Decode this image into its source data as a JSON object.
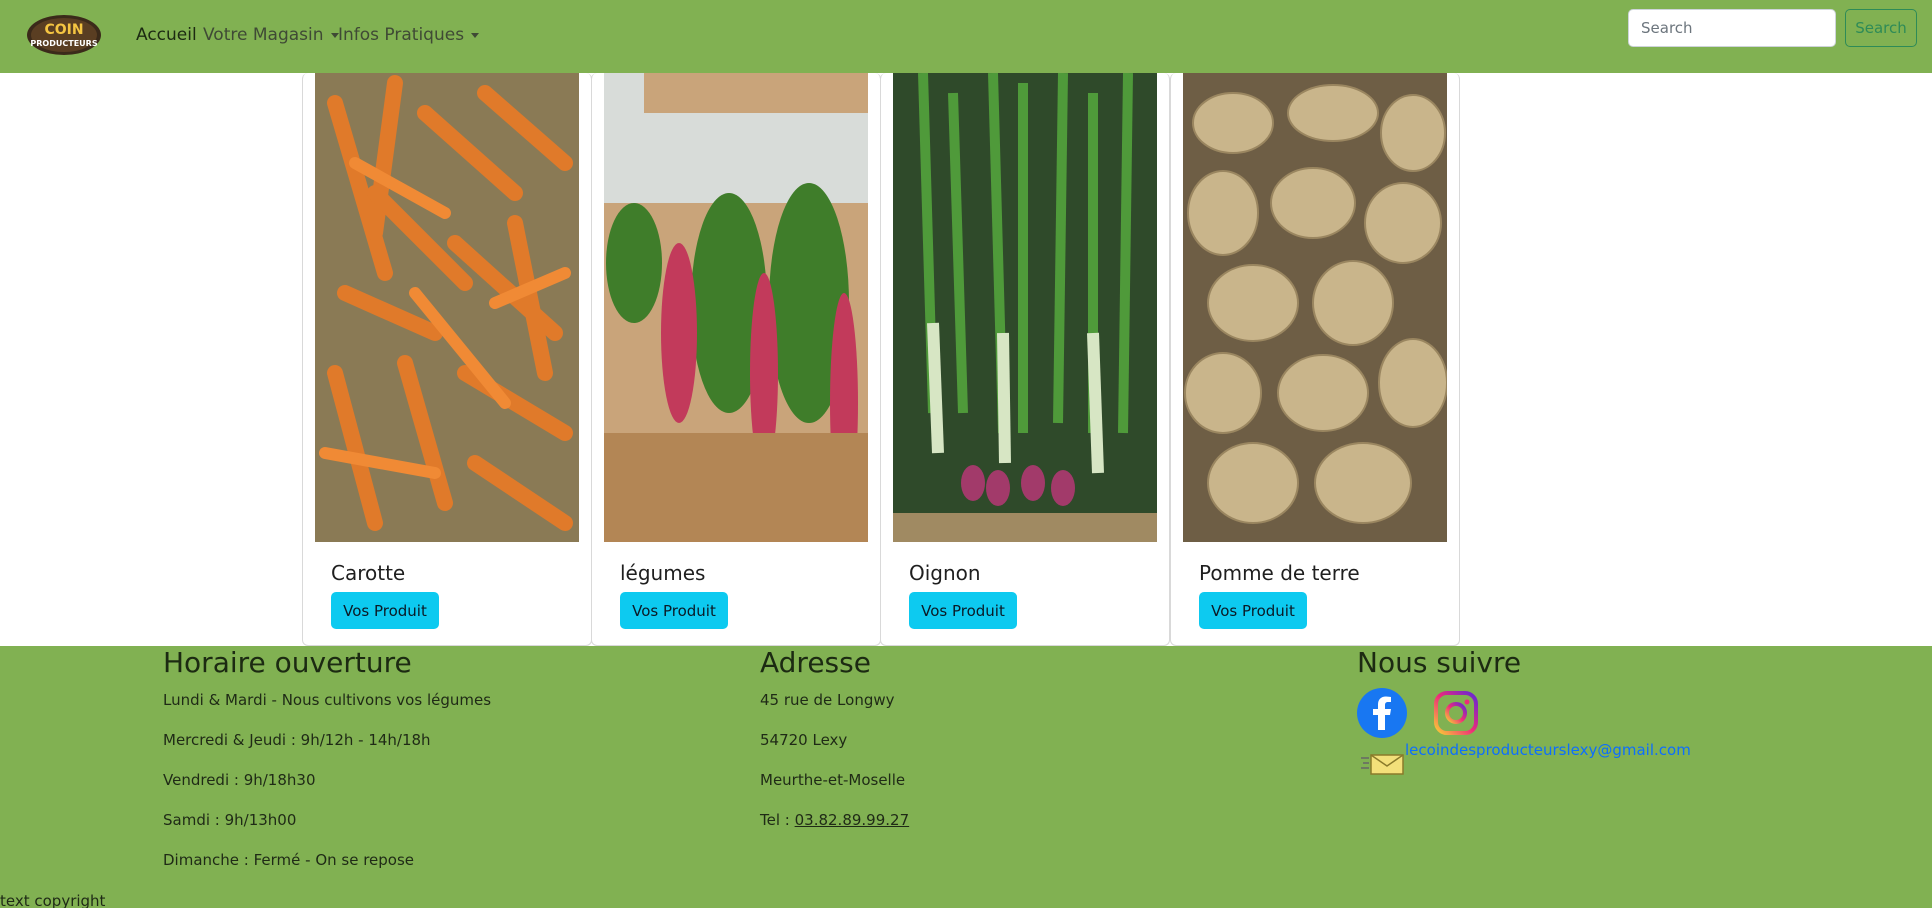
{
  "navbar": {
    "logo_alt": "Le Coin des Producteurs",
    "links": [
      {
        "label": "Accueil",
        "active": true
      },
      {
        "label": "Votre Magasin",
        "dropdown": true
      },
      {
        "label": "Infos Pratiques",
        "dropdown": true
      }
    ],
    "search_placeholder": "Search",
    "search_button": "Search"
  },
  "products": [
    {
      "name": "Carotte",
      "button": "Vos Produit",
      "image": "carrots-photo"
    },
    {
      "name": "légumes",
      "button": "Vos Produit",
      "image": "radish-lettuce-photo"
    },
    {
      "name": "Oignon",
      "button": "Vos Produit",
      "image": "spring-onions-photo"
    },
    {
      "name": "Pomme de terre",
      "button": "Vos Produit",
      "image": "potatoes-photo"
    }
  ],
  "footer": {
    "hours": {
      "title": "Horaire ouverture",
      "lines": [
        "Lundi & Mardi - Nous cultivons vos légumes",
        "Mercredi & Jeudi : 9h/12h - 14h/18h",
        "Vendredi : 9h/18h30",
        "Samdi : 9h/13h00",
        "Dimanche : Fermé - On se repose"
      ]
    },
    "address": {
      "title": "Adresse",
      "street": "45 rue de Longwy",
      "city": "54720 Lexy",
      "region": "Meurthe-et-Moselle",
      "tel_prefix": "Tel : ",
      "tel": "03.82.89.99.27"
    },
    "social": {
      "title": "Nous suivre",
      "email": "lecoindesproducteurslexy@gmail.com",
      "icons": [
        "facebook-icon",
        "instagram-icon",
        "mail-icon"
      ]
    },
    "copyright": "text copyright"
  },
  "colors": {
    "navbar_bg": "#81b152",
    "footer_bg": "#81b152",
    "button_info": "#0dcaf0",
    "search_outline": "#2e8b57",
    "email_link": "#0d6efd"
  }
}
